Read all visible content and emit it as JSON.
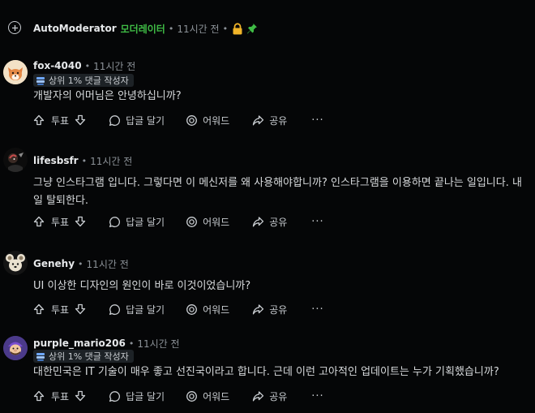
{
  "top_comment": {
    "username": "AutoModerator",
    "mod_label": "모더레이터",
    "time": "11시간 전"
  },
  "actions": {
    "upvote_label": "투표",
    "reply_label": "답글 달기",
    "award_label": "어워드",
    "share_label": "공유",
    "more_label": "···"
  },
  "comments": [
    {
      "username": "fox-4040",
      "time": "11시간 전",
      "badge": "상위 1% 댓글 작성자",
      "body": "개발자의 어머님은 안녕하십니까?"
    },
    {
      "username": "lifesbsfr",
      "time": "11시간 전",
      "body": "그냥 인스타그램 입니다. 그렇다면 이 메신저를 왜 사용해야합니까? 인스타그램을 이용하면 끝나는 일입니다. 내일 탈퇴한다."
    },
    {
      "username": "Genehy",
      "time": "11시간 전",
      "body": "UI 이상한 디자인의 원인이 바로 이것이었습니까?"
    },
    {
      "username": "purple_mario206",
      "time": "11시간 전",
      "badge": "상위 1% 댓글 작성자",
      "body": "대한민국은 IT 기술이 매우 좋고 선진국이라고 합니다. 근데 이런 고아적인 업데이트는 누가 기획했습니까?"
    }
  ],
  "colors": {
    "background": "#050607",
    "text": "#d7dadc",
    "muted": "#8b9197",
    "moderator_green": "#3fbb45",
    "lock_yellow": "#f0b429",
    "badge_bg": "#1d2226"
  }
}
